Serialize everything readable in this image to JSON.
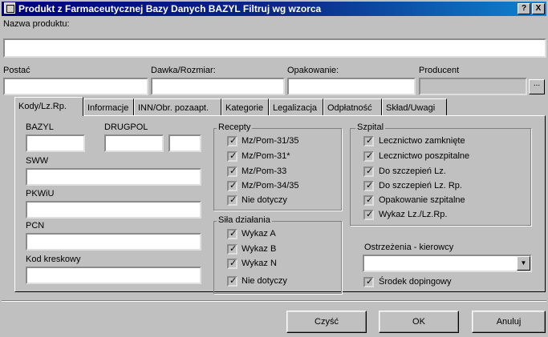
{
  "window": {
    "title": "Produkt z Farmaceutycznej Bazy Danych BAZYL Filtruj wg wzorca",
    "help": "?",
    "close": "X"
  },
  "top": {
    "product_name_label": "Nazwa produktu:",
    "form_label": "Postać",
    "dose_label": "Dawka/Rozmiar:",
    "package_label": "Opakowanie:",
    "producer_label": "Producent",
    "browse_label": "..."
  },
  "tabs": [
    {
      "label": "Kody/Lz.Rp."
    },
    {
      "label": "Informacje"
    },
    {
      "label": "INN/Obr. pozaapt."
    },
    {
      "label": "Kategorie"
    },
    {
      "label": "Legalizacja"
    },
    {
      "label": "Odpłatność"
    },
    {
      "label": "Skład/Uwagi"
    }
  ],
  "codes": {
    "bazyl": "BAZYL",
    "drugpol": "DRUGPOL",
    "sww": "SWW",
    "pkwiu": "PKWiU",
    "pcn": "PCN",
    "barcode": "Kod kreskowy"
  },
  "prescriptions": {
    "title": "Recepty",
    "items": [
      {
        "label": "Mz/Pom-31/35",
        "checked": true
      },
      {
        "label": "Mz/Pom-31*",
        "checked": true
      },
      {
        "label": "Mz/Pom-33",
        "checked": true
      },
      {
        "label": "Mz/Pom-34/35",
        "checked": true
      },
      {
        "label": "Nie dotyczy",
        "checked": true
      }
    ]
  },
  "strength": {
    "title": "Siła działania",
    "items": [
      {
        "label": "Wykaz A",
        "checked": true
      },
      {
        "label": "Wykaz B",
        "checked": true
      },
      {
        "label": "Wykaz N",
        "checked": true
      },
      {
        "label": "Nie dotyczy",
        "checked": true
      }
    ]
  },
  "hospital": {
    "title": "Szpital",
    "items": [
      {
        "label": "Lecznictwo zamknięte",
        "checked": true
      },
      {
        "label": "Lecznictwo poszpitalne",
        "checked": true
      },
      {
        "label": "Do szczepień Lz.",
        "checked": true
      },
      {
        "label": "Do szczepień Lz. Rp.",
        "checked": true
      },
      {
        "label": "Opakowanie szpitalne",
        "checked": true
      },
      {
        "label": "Wykaz Lz./Lz.Rp.",
        "checked": true
      }
    ]
  },
  "warnings": {
    "label": "Ostrzeżenia - kierowcy",
    "value": "",
    "doping": {
      "label": "Środek dopingowy",
      "checked": true
    }
  },
  "buttons": {
    "clear": "Czyść",
    "ok": "OK",
    "cancel": "Anuluj"
  }
}
